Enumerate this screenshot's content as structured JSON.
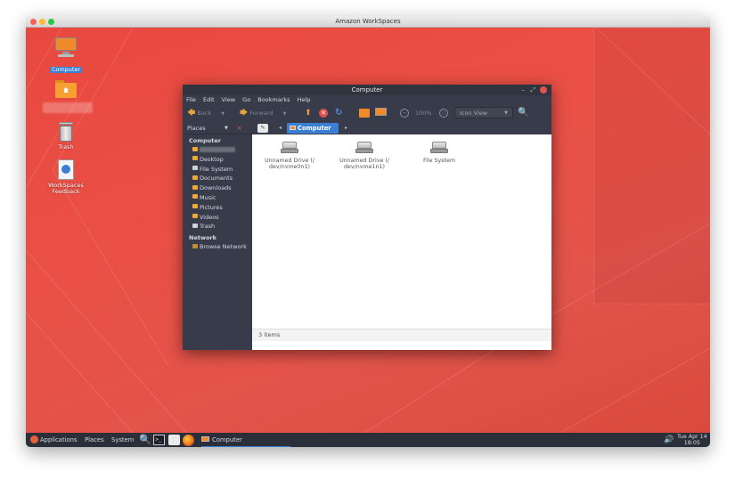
{
  "mac": {
    "title": "Amazon WorkSpaces",
    "dots": [
      "#fc5f57",
      "#fdbc2e",
      "#29c840"
    ]
  },
  "desktop": {
    "icons": [
      {
        "label": "Computer",
        "name": "computer"
      },
      {
        "label": "",
        "name": "home"
      },
      {
        "label": "Trash",
        "name": "trash"
      },
      {
        "label": "WorkSpaces Feedback",
        "name": "feedback"
      }
    ]
  },
  "filemanager": {
    "title": "Computer",
    "controls": {
      "minimize": "–",
      "maximize": "⤢"
    },
    "menu": [
      "File",
      "Edit",
      "View",
      "Go",
      "Bookmarks",
      "Help"
    ],
    "toolbar": {
      "back": "Back",
      "forward": "Forward",
      "zoom": "100%",
      "view_mode": "Icon View"
    },
    "sidebar": {
      "header": "Places",
      "sections": [
        {
          "title": "Computer",
          "items": [
            "",
            "Desktop",
            "File System",
            "Documents",
            "Downloads",
            "Music",
            "Pictures",
            "Videos",
            "Trash"
          ]
        },
        {
          "title": "Network",
          "items": [
            "Browse Network"
          ]
        }
      ]
    },
    "pathbar": {
      "current": "Computer"
    },
    "files": [
      {
        "name": "Unnamed Drive (/dev/nvme0n1)",
        "line1": "Unnamed Drive (/",
        "line2": "dev/nvme0n1)"
      },
      {
        "name": "Unnamed Drive (/dev/nvme1n1)",
        "line1": "Unnamed Drive (/",
        "line2": "dev/nvme1n1)"
      },
      {
        "name": "File System",
        "line1": "File System",
        "line2": ""
      }
    ],
    "status": "3 items"
  },
  "taskbar": {
    "applications": "Applications",
    "places": "Places",
    "system": "System",
    "window_task": "Computer",
    "clock_line1": "Tue Apr 14",
    "clock_line2": "18:05"
  },
  "colors": {
    "desktop_bg": "#e8483f",
    "dark_panel": "#383c4a",
    "accent": "#3b7fd4",
    "folder": "#f0a838"
  }
}
